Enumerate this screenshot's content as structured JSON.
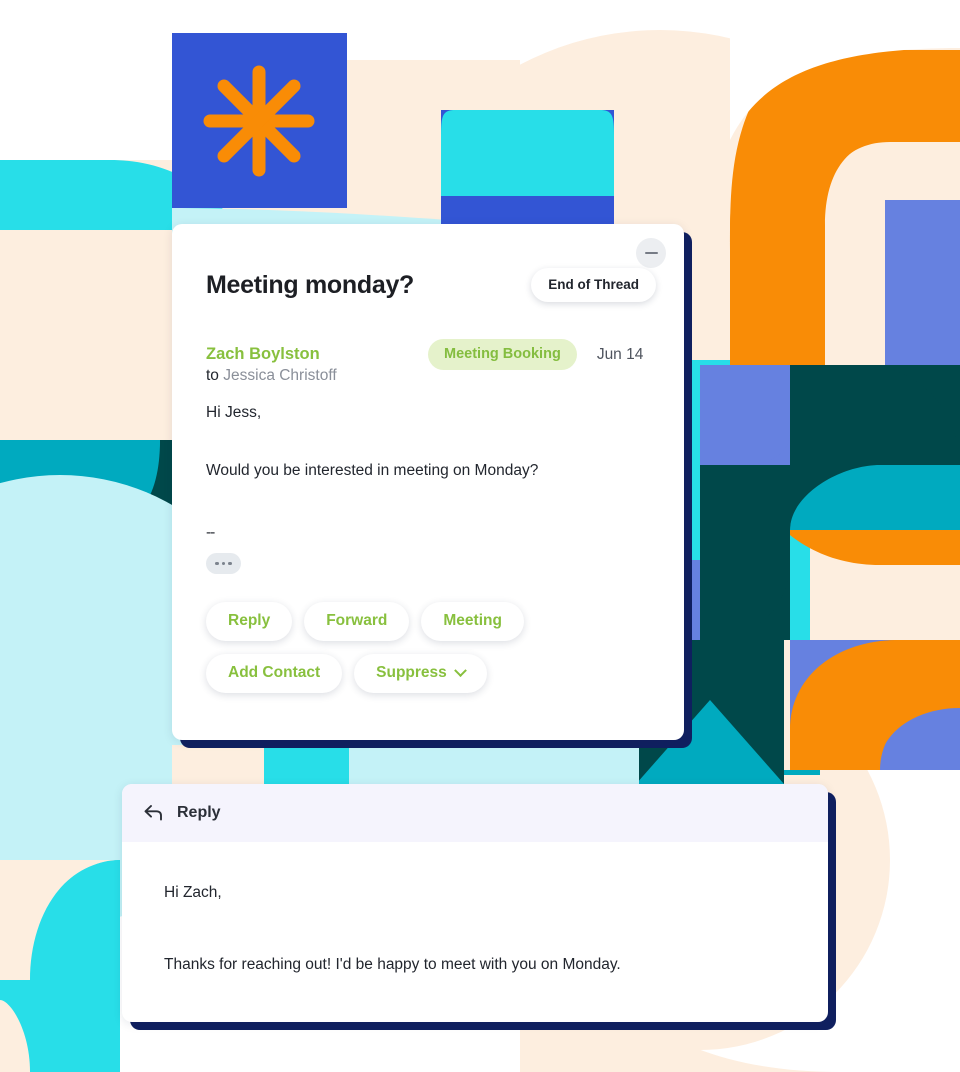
{
  "colors": {
    "cyan": "#28DEE8",
    "cyan_light": "#C4F2F7",
    "teal": "#00AABF",
    "dark_teal": "#00484A",
    "cream": "#FDEEDF",
    "blue": "#3355D4",
    "periwinkle": "#6681E0",
    "orange": "#F98C06",
    "navy_shadow": "#102060",
    "green_accent": "#88C03E",
    "badge_bg": "#E5F2CB",
    "reply_header_bg": "#F5F4FD"
  },
  "thread_card": {
    "title": "Meeting monday?",
    "end_of_thread_label": "End of Thread",
    "minimize_label": "—",
    "sender": "Zach Boylston",
    "badge": "Meeting Booking",
    "date": "Jun 14",
    "to_prefix": "to",
    "recipient": "Jessica Christoff",
    "body": {
      "greeting": "Hi Jess,",
      "question": "Would you be interested in meeting on Monday?",
      "signature_dash": "--",
      "expand_label": "•••"
    },
    "actions_row1": [
      {
        "label": "Reply",
        "name": "reply-button"
      },
      {
        "label": "Forward",
        "name": "forward-button"
      },
      {
        "label": "Meeting",
        "name": "meeting-button"
      }
    ],
    "actions_row2": [
      {
        "label": "Add Contact",
        "name": "add-contact-button",
        "caret": false
      },
      {
        "label": "Suppress",
        "name": "suppress-button",
        "caret": true
      }
    ]
  },
  "reply_card": {
    "header_label": "Reply",
    "body_line1": "Hi Zach,",
    "body_line2": "Thanks for reaching out! I'd be happy to meet with you on Monday."
  }
}
